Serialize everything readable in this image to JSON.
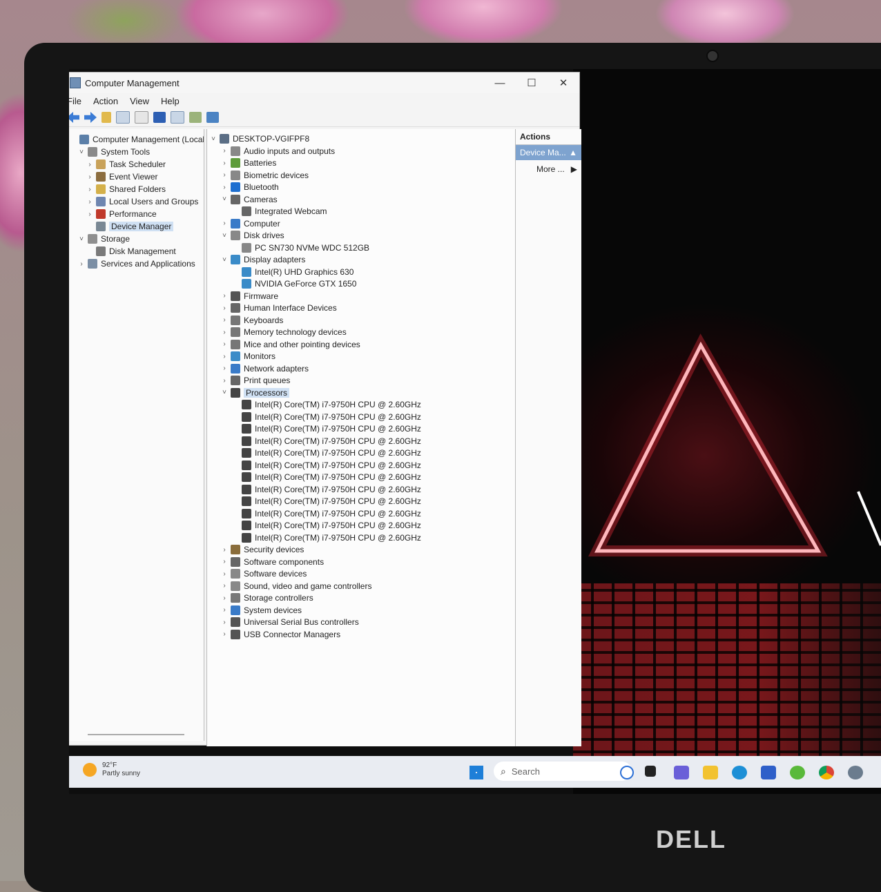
{
  "window": {
    "title": "Computer Management",
    "controls": {
      "minimize": "—",
      "maximize": "☐",
      "close": "✕"
    },
    "menu": [
      "File",
      "Action",
      "View",
      "Help"
    ]
  },
  "left_tree": [
    {
      "label": "Computer Management (Local",
      "chev": "",
      "level": 0,
      "icon": "computer-management-icon",
      "color": "#5b7fa8"
    },
    {
      "label": "System Tools",
      "chev": "˅",
      "level": 1,
      "icon": "system-tools-icon",
      "color": "#8a8a8a"
    },
    {
      "label": "Task Scheduler",
      "chev": "›",
      "level": 2,
      "icon": "clock-icon",
      "color": "#c9a25a"
    },
    {
      "label": "Event Viewer",
      "chev": "›",
      "level": 2,
      "icon": "event-viewer-icon",
      "color": "#8c6d3f"
    },
    {
      "label": "Shared Folders",
      "chev": "›",
      "level": 2,
      "icon": "shared-folder-icon",
      "color": "#d4b04a"
    },
    {
      "label": "Local Users and Groups",
      "chev": "›",
      "level": 2,
      "icon": "users-icon",
      "color": "#6f86b0"
    },
    {
      "label": "Performance",
      "chev": "›",
      "level": 2,
      "icon": "performance-icon",
      "color": "#c0392b"
    },
    {
      "label": "Device Manager",
      "chev": "",
      "level": 2,
      "icon": "device-manager-icon",
      "color": "#7a8894",
      "selected": true
    },
    {
      "label": "Storage",
      "chev": "˅",
      "level": 1,
      "icon": "storage-icon",
      "color": "#8f8f8f"
    },
    {
      "label": "Disk Management",
      "chev": "",
      "level": 2,
      "icon": "disk-icon",
      "color": "#7a7a7a"
    },
    {
      "label": "Services and Applications",
      "chev": "›",
      "level": 1,
      "icon": "services-icon",
      "color": "#7c8fa5"
    }
  ],
  "device_tree": [
    {
      "label": "DESKTOP-VGIFPF8",
      "chev": "˅",
      "level": 0,
      "icon": "pc-icon",
      "color": "#5b6e85"
    },
    {
      "label": "Audio inputs and outputs",
      "chev": "›",
      "level": 1,
      "icon": "speaker-icon",
      "color": "#888"
    },
    {
      "label": "Batteries",
      "chev": "›",
      "level": 1,
      "icon": "battery-icon",
      "color": "#5d9b3a"
    },
    {
      "label": "Biometric devices",
      "chev": "›",
      "level": 1,
      "icon": "biometric-icon",
      "color": "#888"
    },
    {
      "label": "Bluetooth",
      "chev": "›",
      "level": 1,
      "icon": "bluetooth-icon",
      "color": "#1e6fd0"
    },
    {
      "label": "Cameras",
      "chev": "˅",
      "level": 1,
      "icon": "camera-icon",
      "color": "#666"
    },
    {
      "label": "Integrated Webcam",
      "chev": "",
      "level": 2,
      "icon": "webcam-icon",
      "color": "#666"
    },
    {
      "label": "Computer",
      "chev": "›",
      "level": 1,
      "icon": "computer-icon",
      "color": "#3a7bc8"
    },
    {
      "label": "Disk drives",
      "chev": "˅",
      "level": 1,
      "icon": "disk-drive-icon",
      "color": "#888"
    },
    {
      "label": "PC SN730 NVMe WDC 512GB",
      "chev": "",
      "level": 2,
      "icon": "disk-drive-icon",
      "color": "#888"
    },
    {
      "label": "Display adapters",
      "chev": "˅",
      "level": 1,
      "icon": "display-adapter-icon",
      "color": "#3a8bc8"
    },
    {
      "label": "Intel(R) UHD Graphics 630",
      "chev": "",
      "level": 2,
      "icon": "display-adapter-icon",
      "color": "#3a8bc8"
    },
    {
      "label": "NVIDIA GeForce GTX 1650",
      "chev": "",
      "level": 2,
      "icon": "display-adapter-icon",
      "color": "#3a8bc8"
    },
    {
      "label": "Firmware",
      "chev": "›",
      "level": 1,
      "icon": "firmware-icon",
      "color": "#555"
    },
    {
      "label": "Human Interface Devices",
      "chev": "›",
      "level": 1,
      "icon": "hid-icon",
      "color": "#666"
    },
    {
      "label": "Keyboards",
      "chev": "›",
      "level": 1,
      "icon": "keyboard-icon",
      "color": "#777"
    },
    {
      "label": "Memory technology devices",
      "chev": "›",
      "level": 1,
      "icon": "memory-icon",
      "color": "#777"
    },
    {
      "label": "Mice and other pointing devices",
      "chev": "›",
      "level": 1,
      "icon": "mouse-icon",
      "color": "#777"
    },
    {
      "label": "Monitors",
      "chev": "›",
      "level": 1,
      "icon": "monitor-icon",
      "color": "#3a8bc8"
    },
    {
      "label": "Network adapters",
      "chev": "›",
      "level": 1,
      "icon": "network-icon",
      "color": "#3a7bc8"
    },
    {
      "label": "Print queues",
      "chev": "›",
      "level": 1,
      "icon": "printer-icon",
      "color": "#666"
    },
    {
      "label": "Processors",
      "chev": "˅",
      "level": 1,
      "icon": "processor-icon",
      "color": "#444",
      "selected": true
    },
    {
      "label": "Intel(R) Core(TM) i7-9750H CPU @ 2.60GHz",
      "chev": "",
      "level": 2,
      "icon": "processor-icon",
      "color": "#444"
    },
    {
      "label": "Intel(R) Core(TM) i7-9750H CPU @ 2.60GHz",
      "chev": "",
      "level": 2,
      "icon": "processor-icon",
      "color": "#444"
    },
    {
      "label": "Intel(R) Core(TM) i7-9750H CPU @ 2.60GHz",
      "chev": "",
      "level": 2,
      "icon": "processor-icon",
      "color": "#444"
    },
    {
      "label": "Intel(R) Core(TM) i7-9750H CPU @ 2.60GHz",
      "chev": "",
      "level": 2,
      "icon": "processor-icon",
      "color": "#444"
    },
    {
      "label": "Intel(R) Core(TM) i7-9750H CPU @ 2.60GHz",
      "chev": "",
      "level": 2,
      "icon": "processor-icon",
      "color": "#444"
    },
    {
      "label": "Intel(R) Core(TM) i7-9750H CPU @ 2.60GHz",
      "chev": "",
      "level": 2,
      "icon": "processor-icon",
      "color": "#444"
    },
    {
      "label": "Intel(R) Core(TM) i7-9750H CPU @ 2.60GHz",
      "chev": "",
      "level": 2,
      "icon": "processor-icon",
      "color": "#444"
    },
    {
      "label": "Intel(R) Core(TM) i7-9750H CPU @ 2.60GHz",
      "chev": "",
      "level": 2,
      "icon": "processor-icon",
      "color": "#444"
    },
    {
      "label": "Intel(R) Core(TM) i7-9750H CPU @ 2.60GHz",
      "chev": "",
      "level": 2,
      "icon": "processor-icon",
      "color": "#444"
    },
    {
      "label": "Intel(R) Core(TM) i7-9750H CPU @ 2.60GHz",
      "chev": "",
      "level": 2,
      "icon": "processor-icon",
      "color": "#444"
    },
    {
      "label": "Intel(R) Core(TM) i7-9750H CPU @ 2.60GHz",
      "chev": "",
      "level": 2,
      "icon": "processor-icon",
      "color": "#444"
    },
    {
      "label": "Intel(R) Core(TM) i7-9750H CPU @ 2.60GHz",
      "chev": "",
      "level": 2,
      "icon": "processor-icon",
      "color": "#444"
    },
    {
      "label": "Security devices",
      "chev": "›",
      "level": 1,
      "icon": "security-icon",
      "color": "#8a6d3b"
    },
    {
      "label": "Software components",
      "chev": "›",
      "level": 1,
      "icon": "software-component-icon",
      "color": "#666"
    },
    {
      "label": "Software devices",
      "chev": "›",
      "level": 1,
      "icon": "software-device-icon",
      "color": "#888"
    },
    {
      "label": "Sound, video and game controllers",
      "chev": "›",
      "level": 1,
      "icon": "sound-icon",
      "color": "#888"
    },
    {
      "label": "Storage controllers",
      "chev": "›",
      "level": 1,
      "icon": "storage-controller-icon",
      "color": "#777"
    },
    {
      "label": "System devices",
      "chev": "›",
      "level": 1,
      "icon": "system-device-icon",
      "color": "#3a7bc8"
    },
    {
      "label": "Universal Serial Bus controllers",
      "chev": "›",
      "level": 1,
      "icon": "usb-icon",
      "color": "#555"
    },
    {
      "label": "USB Connector Managers",
      "chev": "›",
      "level": 1,
      "icon": "usb-icon",
      "color": "#555"
    }
  ],
  "actions": {
    "header": "Actions",
    "selected": "Device Ma...",
    "selected_arrow": "▲",
    "more": "More ...",
    "more_arrow": "▶"
  },
  "taskbar": {
    "weather_temp": "92°F",
    "weather_desc": "Partly sunny",
    "search_placeholder": "Search",
    "search_icon": "⌕"
  },
  "brand": "DELL"
}
